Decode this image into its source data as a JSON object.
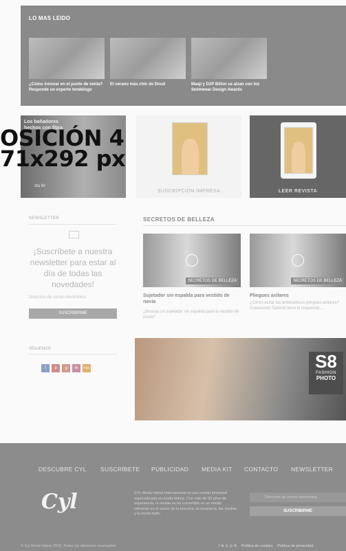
{
  "most_read": {
    "title": "LO MAS LEIDO",
    "items": [
      {
        "caption": "¿Cómo innovar en el punto de venta? Responde un experto tendélogo"
      },
      {
        "caption": "El verano más chic de Dnud"
      },
      {
        "caption": "Maaji y D2P Billon se alzan con los Swimwear Design Awards"
      }
    ]
  },
  "promo": {
    "overlay": "OSICIÓN 4\n71x292 px",
    "card1_title": "Los bañadores\nhechos con fibra",
    "card1_sub": "xta lilr",
    "print_label": "SUSCRIPCIÓN IMPRESA",
    "magazine_label": "LEER REVISTA"
  },
  "newsletter": {
    "title": "NEWSLETTER",
    "text": "¡Suscríbete a nuestra newsletter para estar al día de todas las novedades!",
    "placeholder": "Dirección de correo electrónico",
    "button": "SUSCRIBIRME"
  },
  "follow": {
    "title": "SÍGUENOS",
    "icons": [
      "f",
      "p",
      "g",
      "in",
      "rss"
    ]
  },
  "beauty": {
    "title": "SECRETOS DE BELLEZA",
    "items": [
      {
        "tag": "SECRETOS DE BELLEZA",
        "headline": "Sujetador sin espalda para vestido de novia",
        "summary": "¿Buscas un sujetador sin espalda para tu vestido de novia?"
      },
      {
        "tag": "SECRETOS DE BELLEZA",
        "headline": "Pliegues axilares",
        "summary": "¿Cómo evitar los antiestéticos pliegues axilares? Creaciones Salomé tiene la respuesta..."
      }
    ]
  },
  "banner": {
    "s8": "S8",
    "fashion": "FASHION",
    "photo": "PHOTO"
  },
  "footer": {
    "nav": [
      "DESCUBRE CYL",
      "SUSCRÍBETE",
      "PUBLICIDAD",
      "MEDIA KIT",
      "CONTACTO",
      "NEWSLETTER"
    ],
    "logo": "Cyl",
    "description": "CYL Moda íntima Internacional es una revista trimestral especializada en moda íntima. Con más de 50 años de experiencia, la revista se ha convertido en un medio referente en el sector de la lencería, la corsetería, las medias y la moda baño.",
    "email_placeholder": "Dirección de correo electrónico",
    "subscribe": "SUSCRIBIRME",
    "copyright": "© Cyl Moda Íntima 2019. Todos los derechos reservados",
    "social": "f  ⊕  ♙  ◎  ℝ",
    "cookies": "Política de cookies",
    "privacy": "Política de privacidad"
  }
}
